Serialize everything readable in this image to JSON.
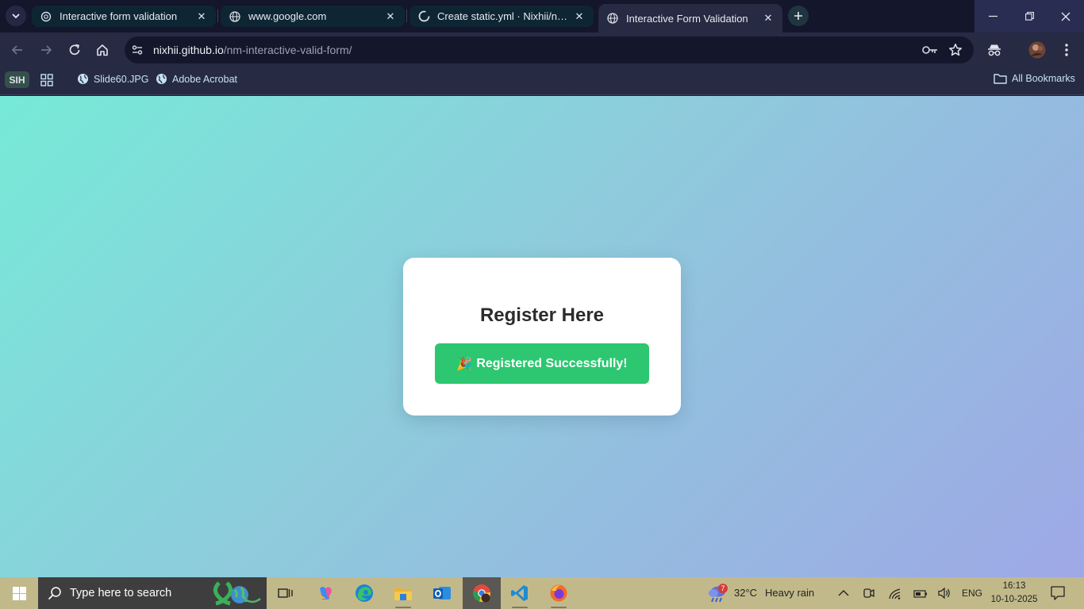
{
  "browser": {
    "tabs": [
      {
        "title": "Interactive form validation",
        "favicon": "chatgpt-icon",
        "active": false
      },
      {
        "title": "www.google.com",
        "favicon": "globe-icon",
        "active": false
      },
      {
        "title": "Create static.yml · Nixhii/nm-interactive-valid-form",
        "favicon": "github-icon",
        "active": false
      },
      {
        "title": "Interactive Form Validation",
        "favicon": "globe-icon",
        "active": true
      }
    ],
    "address": {
      "host": "nixhii.github.io",
      "path": "/nm-interactive-valid-form/"
    },
    "bookmarks": {
      "group_label": "SIH",
      "items": [
        {
          "label": "Slide60.JPG",
          "icon": "globe-icon"
        },
        {
          "label": "Adobe Acrobat",
          "icon": "globe-icon"
        }
      ],
      "all_bookmarks": "All Bookmarks"
    }
  },
  "page": {
    "heading": "Register Here",
    "success_emoji": "🎉",
    "success_text": "Registered Successfully!",
    "colors": {
      "success_button": "#2cc770",
      "gradient_start": "#76ead8",
      "gradient_end": "#9ea8e6"
    }
  },
  "taskbar": {
    "search_placeholder": "Type here to search",
    "weather": {
      "temp": "32°C",
      "condition": "Heavy rain",
      "badge": "7"
    },
    "language": "ENG",
    "time": "16:13",
    "date": "10-10-2025"
  }
}
